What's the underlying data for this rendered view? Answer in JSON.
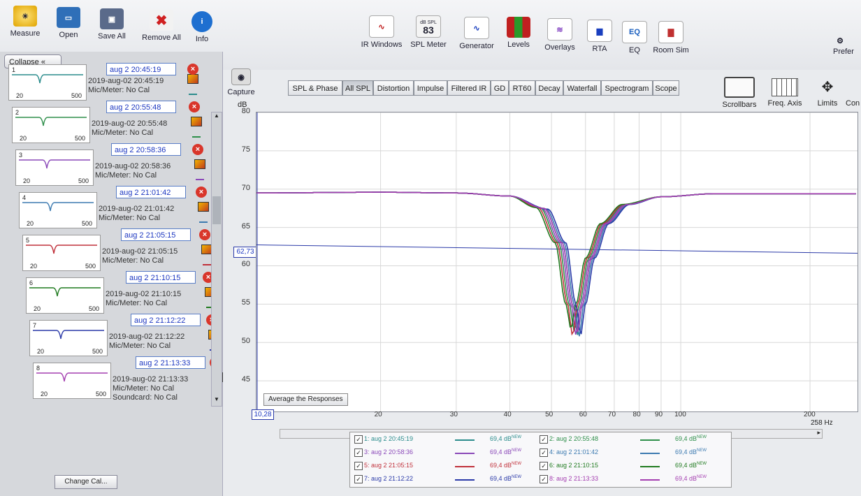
{
  "toolbar": {
    "left_buttons": [
      "Measure",
      "Open",
      "Save All",
      "Remove All",
      "Info"
    ],
    "center_buttons": [
      "IR Windows",
      "SPL Meter",
      "Generator",
      "Levels",
      "Overlays",
      "RTA",
      "EQ",
      "Room Sim"
    ],
    "spl_meter": {
      "unit": "dB SPL",
      "value": "83"
    },
    "right_partial": "Prefer",
    "capture": "Capture"
  },
  "left_panel": {
    "collapse": "Collapse",
    "change_cal": "Change Cal...",
    "measurements": [
      {
        "index": "1",
        "name": "aug 2 20:45:19",
        "date": "2019-aug-02 20:45:19",
        "mic": "Mic/Meter: No Cal",
        "color": "#2a8c8c"
      },
      {
        "index": "2",
        "name": "aug 2 20:55:48",
        "date": "2019-aug-02 20:55:48",
        "mic": "Mic/Meter: No Cal",
        "color": "#2e8f4a"
      },
      {
        "index": "3",
        "name": "aug 2 20:58:36",
        "date": "2019-aug-02 20:58:36",
        "mic": "Mic/Meter: No Cal",
        "color": "#8a48b8"
      },
      {
        "index": "4",
        "name": "aug 2 21:01:42",
        "date": "2019-aug-02 21:01:42",
        "mic": "Mic/Meter: No Cal",
        "color": "#3c7ab0"
      },
      {
        "index": "5",
        "name": "aug 2 21:05:15",
        "date": "2019-aug-02 21:05:15",
        "mic": "Mic/Meter: No Cal",
        "color": "#c0303a"
      },
      {
        "index": "6",
        "name": "aug 2 21:10:15",
        "date": "2019-aug-02 21:10:15",
        "mic": "Mic/Meter: No Cal",
        "color": "#1f7a1f"
      },
      {
        "index": "7",
        "name": "aug 2 21:12:22",
        "date": "2019-aug-02 21:12:22",
        "mic": "Mic/Meter: No Cal",
        "color": "#2b3aa8"
      },
      {
        "index": "8",
        "name": "aug 2 21:13:33",
        "date": "2019-aug-02 21:13:33",
        "mic": "Mic/Meter: No Cal",
        "soundcard": "Soundcard: No Cal",
        "color": "#a43fb0"
      }
    ],
    "thumb_x_min": "20",
    "thumb_x_max": "500"
  },
  "tabs": [
    "SPL & Phase",
    "All SPL",
    "Distortion",
    "Impulse",
    "Filtered IR",
    "GD",
    "RT60",
    "Decay",
    "Waterfall",
    "Spectrogram",
    "Scope"
  ],
  "selected_tab": "All SPL",
  "right_tools": [
    "Scrollbars",
    "Freq. Axis",
    "Limits",
    "Con"
  ],
  "graph": {
    "y_unit": "dB",
    "cursor_value": "62,73",
    "x_cursor_value": "10,28",
    "x_unit_label": "258 Hz",
    "average_button": "Average the Responses"
  },
  "legend": [
    {
      "label": "1: aug 2 20:45:19",
      "value": "69,4 dB",
      "tag": "NEW",
      "color": "#2a8c8c"
    },
    {
      "label": "2: aug 2 20:55:48",
      "value": "69,4 dB",
      "tag": "NEW",
      "color": "#2e8f4a"
    },
    {
      "label": "3: aug 2 20:58:36",
      "value": "69,4 dB",
      "tag": "NEW",
      "color": "#8a48b8"
    },
    {
      "label": "4: aug 2 21:01:42",
      "value": "69,4 dB",
      "tag": "NEW",
      "color": "#3c7ab0"
    },
    {
      "label": "5: aug 2 21:05:15",
      "value": "69,4 dB",
      "tag": "NEW",
      "color": "#c0303a"
    },
    {
      "label": "6: aug 2 21:10:15",
      "value": "69,4 dB",
      "tag": "NEW",
      "color": "#1f7a1f"
    },
    {
      "label": "7: aug 2 21:12:22",
      "value": "69,4 dB",
      "tag": "NEW",
      "color": "#2b3aa8"
    },
    {
      "label": "8: aug 2 21:13:33",
      "value": "69,4 dB",
      "tag": "NEW",
      "color": "#a43fb0"
    }
  ],
  "chart_data": {
    "type": "line",
    "ylabel": "dB",
    "ylim": [
      41,
      80
    ],
    "xlim": [
      10.28,
      258
    ],
    "x_scale": "log",
    "y_ticks": [
      45,
      50,
      55,
      60,
      65,
      70,
      75,
      80
    ],
    "x_ticks": [
      20,
      30,
      40,
      50,
      60,
      70,
      80,
      90,
      100,
      200
    ],
    "x_tick_labels": [
      "20",
      "30",
      "40",
      "50",
      "60",
      "70",
      "80",
      "90",
      "100",
      "200"
    ],
    "grid": true,
    "cursor_y": 62.73,
    "series": [
      {
        "name": "1: aug 2 20:45:19",
        "color": "#2a8c8c",
        "notch_hz": 57.5,
        "x": [
          10.28,
          20,
          30,
          40,
          48,
          53,
          56,
          57.5,
          59,
          62,
          67,
          75,
          90,
          120,
          258
        ],
        "y": [
          69.5,
          69.6,
          69.5,
          69.1,
          67.5,
          63,
          55,
          51,
          55,
          61,
          65.5,
          68,
          69,
          69.4,
          69.4
        ]
      },
      {
        "name": "2: aug 2 20:55:48",
        "color": "#2e8f4a",
        "notch_hz": 56.5,
        "x": [
          10.28,
          20,
          30,
          40,
          47,
          52,
          55,
          56.5,
          58,
          61,
          66,
          74,
          90,
          120,
          258
        ],
        "y": [
          69.5,
          69.6,
          69.5,
          69.1,
          67.6,
          63,
          55,
          51.5,
          55,
          61,
          65.5,
          68,
          69,
          69.4,
          69.4
        ]
      },
      {
        "name": "3: aug 2 20:58:36",
        "color": "#8a48b8",
        "notch_hz": 57,
        "x": [
          10.28,
          20,
          30,
          40,
          47.5,
          52.5,
          55.5,
          57,
          58.5,
          61.5,
          66.5,
          74.5,
          90,
          120,
          258
        ],
        "y": [
          69.5,
          69.6,
          69.5,
          69.1,
          67.5,
          63,
          55,
          51,
          55,
          61,
          65.5,
          68,
          69,
          69.4,
          69.4
        ]
      },
      {
        "name": "4: aug 2 21:01:42",
        "color": "#3c7ab0",
        "notch_hz": 58,
        "x": [
          10.28,
          20,
          30,
          40,
          48.5,
          53.5,
          56.5,
          58,
          59.5,
          62.5,
          67.5,
          75.5,
          90,
          120,
          258
        ],
        "y": [
          69.5,
          69.6,
          69.5,
          69.1,
          67.4,
          63,
          55,
          50.8,
          55,
          61,
          65.5,
          68,
          69,
          69.4,
          69.4
        ]
      },
      {
        "name": "5: aug 2 21:05:15",
        "color": "#c0303a",
        "notch_hz": 56,
        "x": [
          10.28,
          20,
          30,
          40,
          46.5,
          51.5,
          54.5,
          56,
          57.5,
          60.5,
          65.5,
          73.5,
          90,
          120,
          258
        ],
        "y": [
          69.5,
          69.6,
          69.5,
          69.1,
          67.6,
          63,
          55,
          50.9,
          55,
          61,
          65.5,
          68,
          69,
          69.4,
          69.4
        ]
      },
      {
        "name": "6: aug 2 21:10:15",
        "color": "#1f7a1f",
        "notch_hz": 55.5,
        "x": [
          10.28,
          20,
          30,
          40,
          46,
          51,
          54,
          55.5,
          57,
          60,
          65,
          73,
          90,
          120,
          258
        ],
        "y": [
          69.5,
          69.6,
          69.5,
          69.1,
          67.6,
          63,
          55,
          51.8,
          55,
          61,
          65.5,
          68,
          69,
          69.4,
          69.4
        ]
      },
      {
        "name": "7: aug 2 21:12:22",
        "color": "#2b3aa8",
        "notch_hz": 58.5,
        "x": [
          10.28,
          20,
          30,
          40,
          49,
          54,
          57,
          58.5,
          60,
          63,
          68,
          76,
          90,
          120,
          258
        ],
        "y": [
          69.5,
          69.6,
          69.5,
          69.1,
          67.4,
          63,
          55,
          51,
          55,
          61,
          65.5,
          68,
          69,
          69.4,
          69.4
        ]
      },
      {
        "name": "8: aug 2 21:13:33",
        "color": "#a43fb0",
        "notch_hz": 57.5,
        "x": [
          10.28,
          20,
          30,
          40,
          48,
          53,
          56,
          57.5,
          59,
          62,
          67,
          75,
          90,
          120,
          258
        ],
        "y": [
          69.5,
          69.6,
          69.5,
          69.1,
          67.5,
          63,
          55,
          51.4,
          55,
          61,
          65.5,
          68,
          69,
          69.4,
          69.4
        ]
      }
    ]
  }
}
